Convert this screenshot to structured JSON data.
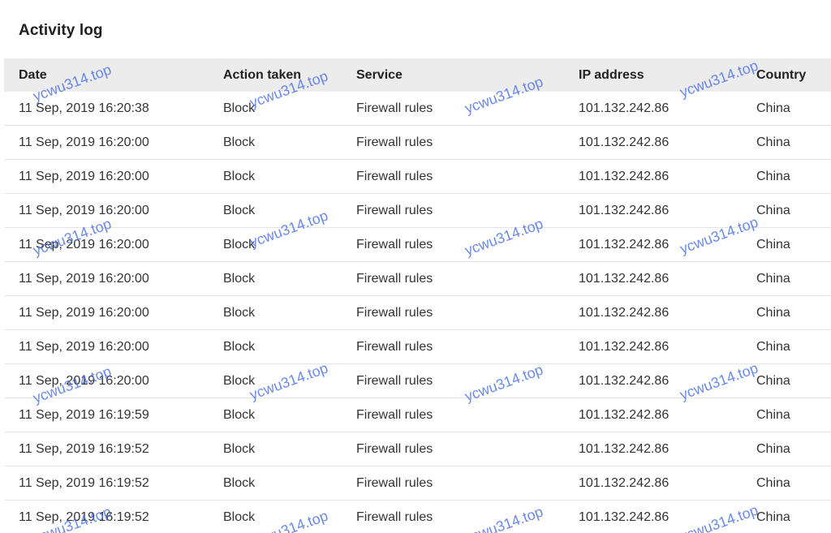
{
  "page": {
    "title": "Activity log"
  },
  "table": {
    "headers": {
      "date": "Date",
      "action": "Action taken",
      "service": "Service",
      "ip": "IP address",
      "country": "Country"
    },
    "rows": [
      {
        "date": "11 Sep, 2019 16:20:38",
        "action": "Block",
        "service": "Firewall rules",
        "ip": "101.132.242.86",
        "country": "China"
      },
      {
        "date": "11 Sep, 2019 16:20:00",
        "action": "Block",
        "service": "Firewall rules",
        "ip": "101.132.242.86",
        "country": "China"
      },
      {
        "date": "11 Sep, 2019 16:20:00",
        "action": "Block",
        "service": "Firewall rules",
        "ip": "101.132.242.86",
        "country": "China"
      },
      {
        "date": "11 Sep, 2019 16:20:00",
        "action": "Block",
        "service": "Firewall rules",
        "ip": "101.132.242.86",
        "country": "China"
      },
      {
        "date": "11 Sep, 2019 16:20:00",
        "action": "Block",
        "service": "Firewall rules",
        "ip": "101.132.242.86",
        "country": "China"
      },
      {
        "date": "11 Sep, 2019 16:20:00",
        "action": "Block",
        "service": "Firewall rules",
        "ip": "101.132.242.86",
        "country": "China"
      },
      {
        "date": "11 Sep, 2019 16:20:00",
        "action": "Block",
        "service": "Firewall rules",
        "ip": "101.132.242.86",
        "country": "China"
      },
      {
        "date": "11 Sep, 2019 16:20:00",
        "action": "Block",
        "service": "Firewall rules",
        "ip": "101.132.242.86",
        "country": "China"
      },
      {
        "date": "11 Sep, 2019 16:20:00",
        "action": "Block",
        "service": "Firewall rules",
        "ip": "101.132.242.86",
        "country": "China"
      },
      {
        "date": "11 Sep, 2019 16:19:59",
        "action": "Block",
        "service": "Firewall rules",
        "ip": "101.132.242.86",
        "country": "China"
      },
      {
        "date": "11 Sep, 2019 16:19:52",
        "action": "Block",
        "service": "Firewall rules",
        "ip": "101.132.242.86",
        "country": "China"
      },
      {
        "date": "11 Sep, 2019 16:19:52",
        "action": "Block",
        "service": "Firewall rules",
        "ip": "101.132.242.86",
        "country": "China"
      },
      {
        "date": "11 Sep, 2019 16:19:52",
        "action": "Block",
        "service": "Firewall rules",
        "ip": "101.132.242.86",
        "country": "China"
      }
    ]
  },
  "watermark": {
    "text": "ycwu314.top",
    "color": "#466ee6"
  }
}
